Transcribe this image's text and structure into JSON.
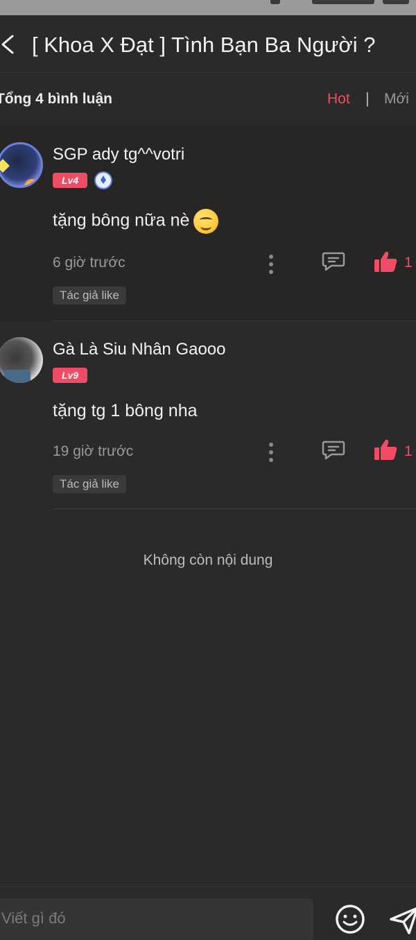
{
  "header": {
    "title": "[ Khoa X Đạt ] Tình Bạn Ba Người ?"
  },
  "subbar": {
    "total": "Tổng 4 bình luận",
    "sort_hot": "Hot",
    "sort_separator": "|",
    "sort_new": "Mới"
  },
  "comments": [
    {
      "username": "SGP ady tg^^votri",
      "level": "Lv4",
      "text": "tặng bông nữa nè",
      "time": "6 giờ trước",
      "likes": "1",
      "tag": "Tác giả like"
    },
    {
      "username": "Gà Là Siu Nhân Gaooo",
      "level": "Lv9",
      "text": "tặng tg 1 bông nha",
      "time": "19 giờ trước",
      "likes": "1",
      "tag": "Tác giả like"
    }
  ],
  "end_text": "Không còn nội dung",
  "composer": {
    "placeholder": "Viết gì đó"
  },
  "colors": {
    "accent": "#ef4d66",
    "background": "#2a2a2a"
  }
}
